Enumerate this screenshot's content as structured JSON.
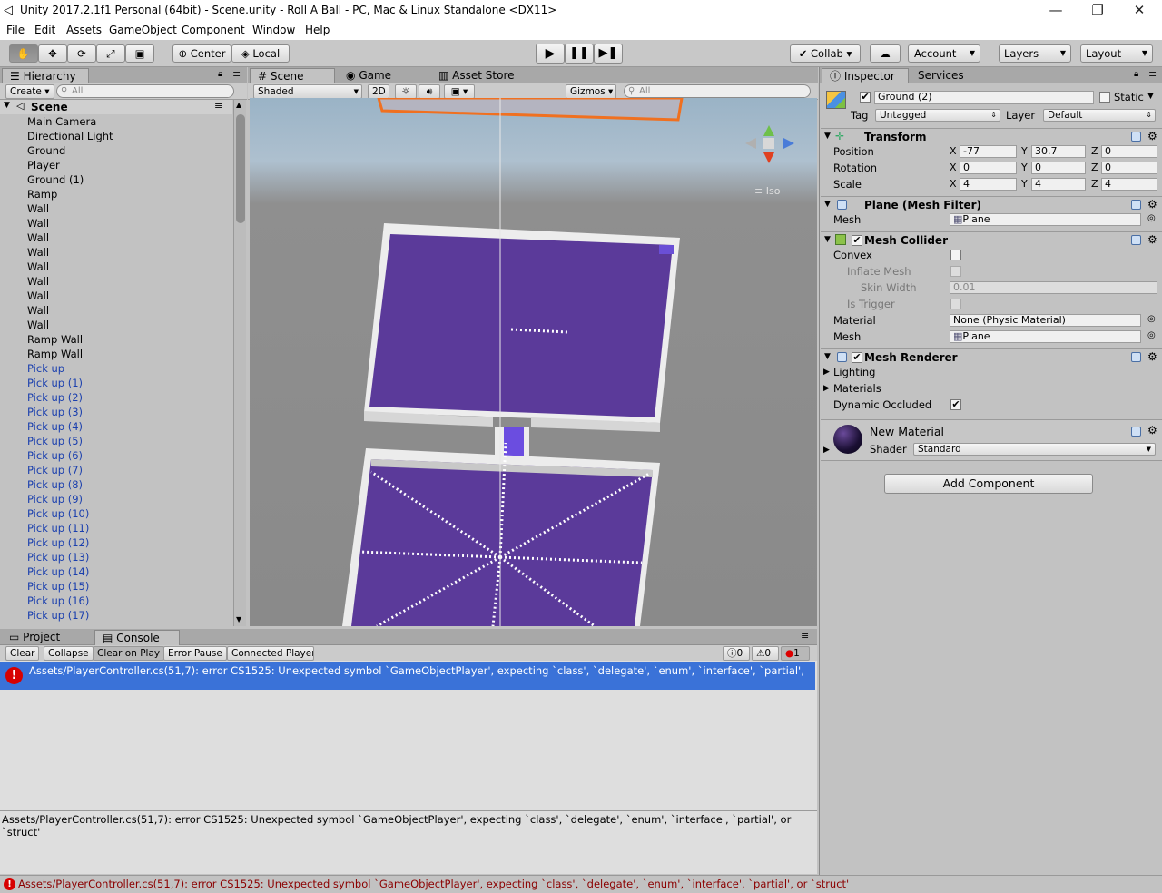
{
  "window": {
    "title": "Unity 2017.2.1f1 Personal (64bit) - Scene.unity - Roll A Ball - PC, Mac & Linux Standalone <DX11>",
    "minimize": "—",
    "maximize": "❐",
    "close": "✕"
  },
  "menu": [
    "File",
    "Edit",
    "Assets",
    "GameObject",
    "Component",
    "Window",
    "Help"
  ],
  "toolbar": {
    "pivot": "Center",
    "space": "Local",
    "collab": "Collab ▾",
    "account": "Account",
    "layers": "Layers",
    "layout": "Layout"
  },
  "hierarchy": {
    "tab": "Hierarchy",
    "create": "Create",
    "search_placeholder": "All",
    "scene": "Scene",
    "items": [
      {
        "name": "Main Camera",
        "prefab": false
      },
      {
        "name": "Directional Light",
        "prefab": false
      },
      {
        "name": "Ground",
        "prefab": false
      },
      {
        "name": "Player",
        "prefab": false
      },
      {
        "name": "Ground (1)",
        "prefab": false
      },
      {
        "name": "Ramp",
        "prefab": false
      },
      {
        "name": "Wall",
        "prefab": false
      },
      {
        "name": "Wall",
        "prefab": false
      },
      {
        "name": "Wall",
        "prefab": false
      },
      {
        "name": "Wall",
        "prefab": false
      },
      {
        "name": "Wall",
        "prefab": false
      },
      {
        "name": "Wall",
        "prefab": false
      },
      {
        "name": "Wall",
        "prefab": false
      },
      {
        "name": "Wall",
        "prefab": false
      },
      {
        "name": "Wall",
        "prefab": false
      },
      {
        "name": "Ramp Wall",
        "prefab": false
      },
      {
        "name": "Ramp Wall",
        "prefab": false
      },
      {
        "name": "Pick up",
        "prefab": true
      },
      {
        "name": "Pick up (1)",
        "prefab": true
      },
      {
        "name": "Pick up (2)",
        "prefab": true
      },
      {
        "name": "Pick up (3)",
        "prefab": true
      },
      {
        "name": "Pick up (4)",
        "prefab": true
      },
      {
        "name": "Pick up (5)",
        "prefab": true
      },
      {
        "name": "Pick up (6)",
        "prefab": true
      },
      {
        "name": "Pick up (7)",
        "prefab": true
      },
      {
        "name": "Pick up (8)",
        "prefab": true
      },
      {
        "name": "Pick up (9)",
        "prefab": true
      },
      {
        "name": "Pick up (10)",
        "prefab": true
      },
      {
        "name": "Pick up (11)",
        "prefab": true
      },
      {
        "name": "Pick up (12)",
        "prefab": true
      },
      {
        "name": "Pick up (13)",
        "prefab": true
      },
      {
        "name": "Pick up (14)",
        "prefab": true
      },
      {
        "name": "Pick up (15)",
        "prefab": true
      },
      {
        "name": "Pick up (16)",
        "prefab": true
      },
      {
        "name": "Pick up (17)",
        "prefab": true
      }
    ]
  },
  "scene": {
    "tabs": {
      "scene": "Scene",
      "game": "Game",
      "asset_store": "Asset Store"
    },
    "shading": "Shaded",
    "mode_2d": "2D",
    "gizmos": "Gizmos",
    "search_placeholder": "All",
    "view_label": "Iso"
  },
  "inspector": {
    "tabs": {
      "inspector": "Inspector",
      "services": "Services"
    },
    "object_name": "Ground (2)",
    "static_label": "Static",
    "tag_label": "Tag",
    "tag_value": "Untagged",
    "layer_label": "Layer",
    "layer_value": "Default",
    "transform": {
      "title": "Transform",
      "position_label": "Position",
      "rotation_label": "Rotation",
      "scale_label": "Scale",
      "axis": {
        "x": "X",
        "y": "Y",
        "z": "Z"
      },
      "position": {
        "x": "-77",
        "y": "30.7",
        "z": "0"
      },
      "rotation": {
        "x": "0",
        "y": "0",
        "z": "0"
      },
      "scale": {
        "x": "4",
        "y": "4",
        "z": "4"
      }
    },
    "mesh_filter": {
      "title": "Plane (Mesh Filter)",
      "mesh_label": "Mesh",
      "mesh_value": "Plane"
    },
    "mesh_collider": {
      "title": "Mesh Collider",
      "convex": "Convex",
      "inflate_mesh": "Inflate Mesh",
      "skin_width": "Skin Width",
      "skin_width_value": "0.01",
      "is_trigger": "Is Trigger",
      "material_label": "Material",
      "material_value": "None (Physic Material)",
      "mesh_label": "Mesh",
      "mesh_value": "Plane"
    },
    "mesh_renderer": {
      "title": "Mesh Renderer",
      "lighting": "Lighting",
      "materials": "Materials",
      "dynamic_occluded": "Dynamic Occluded"
    },
    "material": {
      "name": "New Material",
      "shader_label": "Shader",
      "shader_value": "Standard"
    },
    "add_component": "Add Component"
  },
  "console": {
    "tabs": {
      "project": "Project",
      "console": "Console"
    },
    "buttons": {
      "clear": "Clear",
      "collapse": "Collapse",
      "clear_on_play": "Clear on Play",
      "error_pause": "Error Pause",
      "connected_player": "Connected Player"
    },
    "counts": {
      "logs": "0",
      "warnings": "0",
      "errors": "1"
    },
    "error_line": "Assets/PlayerController.cs(51,7): error CS1525: Unexpected symbol `GameObjectPlayer', expecting `class', `delegate', `enum', `interface', `partial',",
    "detail": "Assets/PlayerController.cs(51,7): error CS1525: Unexpected symbol `GameObjectPlayer', expecting `class', `delegate', `enum', `interface', `partial', or `struct'",
    "status": "Assets/PlayerController.cs(51,7): error CS1525: Unexpected symbol `GameObjectPlayer', expecting `class', `delegate', `enum', `interface', `partial', or `struct'"
  }
}
